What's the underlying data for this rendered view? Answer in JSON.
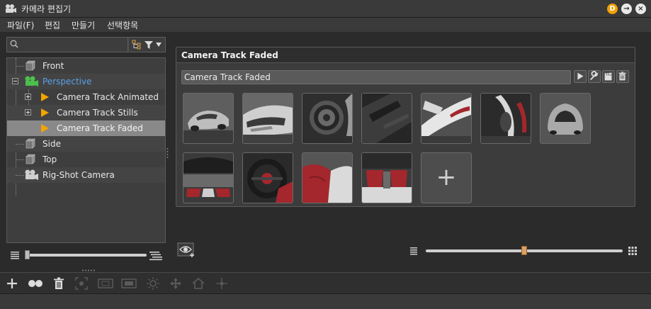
{
  "window": {
    "title": "카메라 편집기",
    "title_buttons": [
      "D",
      "→",
      "×"
    ]
  },
  "menu": {
    "items": [
      "파일(F)",
      "편집",
      "만들기",
      "선택항목"
    ]
  },
  "search": {
    "placeholder": "",
    "value": ""
  },
  "tree": {
    "items": [
      {
        "label": "Front",
        "icon": "camera-cube-icon",
        "level": 0,
        "highlight": false
      },
      {
        "label": "Perspective",
        "icon": "perspective-camera-icon",
        "level": 0,
        "highlight": true,
        "expanded": true
      },
      {
        "label": "Camera Track Animated",
        "icon": "play-triangle-icon",
        "level": 1
      },
      {
        "label": "Camera Track Stills",
        "icon": "play-triangle-icon",
        "level": 1
      },
      {
        "label": "Camera Track Faded",
        "icon": "play-triangle-icon",
        "level": 1,
        "selected": true
      },
      {
        "label": "Side",
        "icon": "camera-cube-icon",
        "level": 0
      },
      {
        "label": "Top",
        "icon": "camera-cube-icon",
        "level": 0
      },
      {
        "label": "Rig-Shot Camera",
        "icon": "rig-camera-icon",
        "level": 0
      }
    ]
  },
  "track_panel": {
    "header": "Camera Track Faded",
    "name_value": "Camera Track Faded",
    "add_label": "+"
  },
  "colors": {
    "accent_orange": "#f2a400",
    "highlight_blue": "#5aa0e6",
    "selection_gray": "#898989",
    "car_red": "#a3272c"
  }
}
